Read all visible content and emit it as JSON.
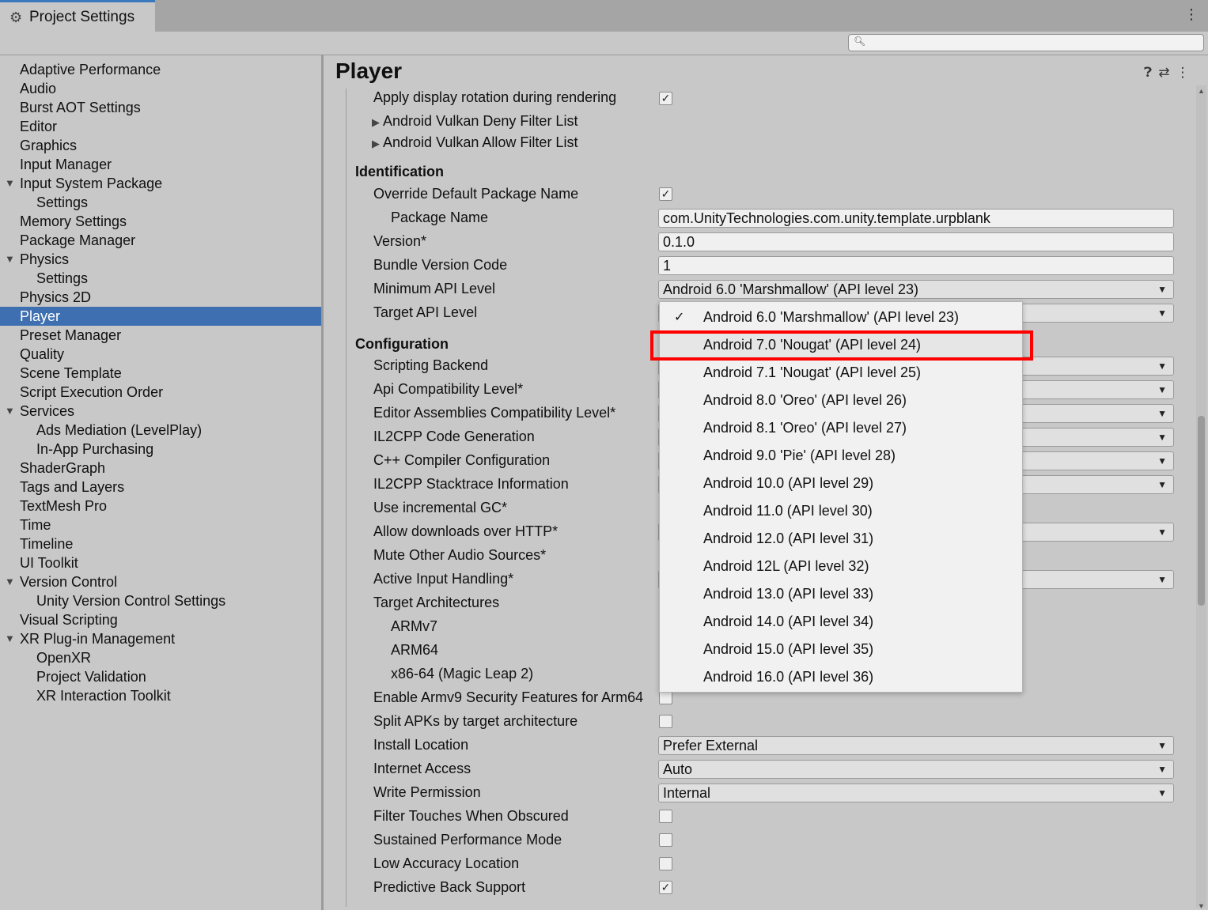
{
  "window": {
    "tab_title": "Project Settings",
    "tab_icon": "gear-icon",
    "menu_icon": "kebab-icon",
    "search_placeholder": ""
  },
  "sidebar": {
    "items": [
      {
        "label": "Adaptive Performance",
        "level": 0,
        "expanded": null,
        "selected": false
      },
      {
        "label": "Audio",
        "level": 0,
        "expanded": null,
        "selected": false
      },
      {
        "label": "Burst AOT Settings",
        "level": 0,
        "expanded": null,
        "selected": false
      },
      {
        "label": "Editor",
        "level": 0,
        "expanded": null,
        "selected": false
      },
      {
        "label": "Graphics",
        "level": 0,
        "expanded": null,
        "selected": false
      },
      {
        "label": "Input Manager",
        "level": 0,
        "expanded": null,
        "selected": false
      },
      {
        "label": "Input System Package",
        "level": 0,
        "expanded": true,
        "selected": false
      },
      {
        "label": "Settings",
        "level": 1,
        "expanded": null,
        "selected": false
      },
      {
        "label": "Memory Settings",
        "level": 0,
        "expanded": null,
        "selected": false
      },
      {
        "label": "Package Manager",
        "level": 0,
        "expanded": null,
        "selected": false
      },
      {
        "label": "Physics",
        "level": 0,
        "expanded": true,
        "selected": false
      },
      {
        "label": "Settings",
        "level": 1,
        "expanded": null,
        "selected": false
      },
      {
        "label": "Physics 2D",
        "level": 0,
        "expanded": null,
        "selected": false
      },
      {
        "label": "Player",
        "level": 0,
        "expanded": null,
        "selected": true
      },
      {
        "label": "Preset Manager",
        "level": 0,
        "expanded": null,
        "selected": false
      },
      {
        "label": "Quality",
        "level": 0,
        "expanded": null,
        "selected": false
      },
      {
        "label": "Scene Template",
        "level": 0,
        "expanded": null,
        "selected": false
      },
      {
        "label": "Script Execution Order",
        "level": 0,
        "expanded": null,
        "selected": false
      },
      {
        "label": "Services",
        "level": 0,
        "expanded": true,
        "selected": false
      },
      {
        "label": "Ads Mediation (LevelPlay)",
        "level": 1,
        "expanded": null,
        "selected": false
      },
      {
        "label": "In-App Purchasing",
        "level": 1,
        "expanded": null,
        "selected": false
      },
      {
        "label": "ShaderGraph",
        "level": 0,
        "expanded": null,
        "selected": false
      },
      {
        "label": "Tags and Layers",
        "level": 0,
        "expanded": null,
        "selected": false
      },
      {
        "label": "TextMesh Pro",
        "level": 0,
        "expanded": null,
        "selected": false
      },
      {
        "label": "Time",
        "level": 0,
        "expanded": null,
        "selected": false
      },
      {
        "label": "Timeline",
        "level": 0,
        "expanded": null,
        "selected": false
      },
      {
        "label": "UI Toolkit",
        "level": 0,
        "expanded": null,
        "selected": false
      },
      {
        "label": "Version Control",
        "level": 0,
        "expanded": true,
        "selected": false
      },
      {
        "label": "Unity Version Control Settings",
        "level": 1,
        "expanded": null,
        "selected": false
      },
      {
        "label": "Visual Scripting",
        "level": 0,
        "expanded": null,
        "selected": false
      },
      {
        "label": "XR Plug-in Management",
        "level": 0,
        "expanded": true,
        "selected": false
      },
      {
        "label": "OpenXR",
        "level": 1,
        "expanded": null,
        "selected": false
      },
      {
        "label": "Project Validation",
        "level": 1,
        "expanded": null,
        "selected": false
      },
      {
        "label": "XR Interaction Toolkit",
        "level": 1,
        "expanded": null,
        "selected": false
      }
    ]
  },
  "main": {
    "title": "Player",
    "header_icons": [
      "help-icon",
      "preset-icon",
      "kebab-icon"
    ],
    "rows": {
      "apply_rotation": {
        "label": "Apply display rotation during rendering",
        "checked": true
      },
      "vulkan_deny": {
        "label": "Android Vulkan Deny Filter List"
      },
      "vulkan_allow": {
        "label": "Android Vulkan Allow Filter List"
      },
      "identification": {
        "label": "Identification"
      },
      "override_pkg": {
        "label": "Override Default Package Name",
        "checked": true
      },
      "package_name": {
        "label": "Package Name",
        "value": "com.UnityTechnologies.com.unity.template.urpblank"
      },
      "version": {
        "label": "Version*",
        "value": "0.1.0"
      },
      "bundle_code": {
        "label": "Bundle Version Code",
        "value": "1"
      },
      "min_api": {
        "label": "Minimum API Level",
        "value": "Android 6.0 'Marshmallow' (API level 23)"
      },
      "target_api": {
        "label": "Target API Level",
        "value": ""
      },
      "configuration": {
        "label": "Configuration"
      },
      "scripting_backend": {
        "label": "Scripting Backend"
      },
      "api_compat": {
        "label": "Api Compatibility Level*"
      },
      "editor_asm": {
        "label": "Editor Assemblies Compatibility Level*"
      },
      "il2cpp_codegen": {
        "label": "IL2CPP Code Generation"
      },
      "cpp_compiler": {
        "label": "C++ Compiler Configuration"
      },
      "il2cpp_stack": {
        "label": "IL2CPP Stacktrace Information"
      },
      "incremental_gc": {
        "label": "Use incremental GC*"
      },
      "allow_http": {
        "label": "Allow downloads over HTTP*"
      },
      "mute_audio": {
        "label": "Mute Other Audio Sources*"
      },
      "active_input": {
        "label": "Active Input Handling*"
      },
      "target_arch": {
        "label": "Target Architectures"
      },
      "armv7": {
        "label": "ARMv7"
      },
      "arm64": {
        "label": "ARM64"
      },
      "x86_64": {
        "label": "x86-64 (Magic Leap 2)"
      },
      "armv9": {
        "label": "Enable Armv9 Security Features for Arm64",
        "checked": false
      },
      "split_apks": {
        "label": "Split APKs by target architecture",
        "checked": false
      },
      "install_location": {
        "label": "Install Location",
        "value": "Prefer External"
      },
      "internet_access": {
        "label": "Internet Access",
        "value": "Auto"
      },
      "write_permission": {
        "label": "Write Permission",
        "value": "Internal"
      },
      "filter_touches": {
        "label": "Filter Touches When Obscured",
        "checked": false
      },
      "sustained_perf": {
        "label": "Sustained Performance Mode",
        "checked": false
      },
      "low_accuracy": {
        "label": "Low Accuracy Location",
        "checked": false
      },
      "predictive_back": {
        "label": "Predictive Back Support",
        "checked": true
      }
    }
  },
  "popup": {
    "items": [
      {
        "label": "Android 6.0 'Marshmallow' (API level 23)",
        "checked": true
      },
      {
        "label": "Android 7.0 'Nougat' (API level 24)",
        "checked": false,
        "highlighted": true
      },
      {
        "label": "Android 7.1 'Nougat' (API level 25)",
        "checked": false
      },
      {
        "label": "Android 8.0 'Oreo' (API level 26)",
        "checked": false
      },
      {
        "label": "Android 8.1 'Oreo' (API level 27)",
        "checked": false
      },
      {
        "label": "Android 9.0 'Pie' (API level 28)",
        "checked": false
      },
      {
        "label": "Android 10.0 (API level 29)",
        "checked": false
      },
      {
        "label": "Android 11.0 (API level 30)",
        "checked": false
      },
      {
        "label": "Android 12.0 (API level 31)",
        "checked": false
      },
      {
        "label": "Android 12L (API level 32)",
        "checked": false
      },
      {
        "label": "Android 13.0 (API level 33)",
        "checked": false
      },
      {
        "label": "Android 14.0 (API level 34)",
        "checked": false
      },
      {
        "label": "Android 15.0 (API level 35)",
        "checked": false
      },
      {
        "label": "Android 16.0 (API level 36)",
        "checked": false
      }
    ],
    "highlight_color": "#ff0000"
  },
  "colors": {
    "selection": "#3e6fb0",
    "tab_accent": "#3a79bb",
    "panel_bg": "#c8c8c8"
  }
}
